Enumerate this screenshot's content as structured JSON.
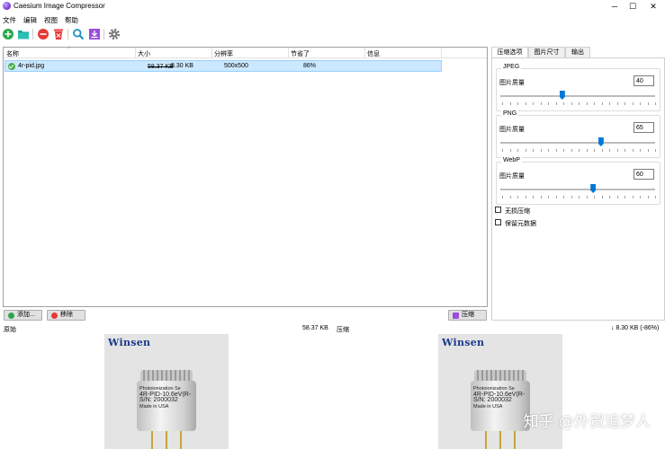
{
  "window": {
    "title": "Caesium Image Compressor",
    "minimize": "─",
    "maximize": "☐",
    "close": "✕"
  },
  "menu": [
    "文件",
    "编辑",
    "视图",
    "帮助"
  ],
  "toolbar": [
    "add-icon",
    "folder-icon",
    "remove-icon",
    "clear-icon",
    "search-icon",
    "export-icon",
    "settings-icon"
  ],
  "list": {
    "headers": [
      "名称",
      "大小",
      "分辨率",
      "节省了",
      "信息"
    ],
    "rows": [
      {
        "name": "4r-pid.jpg",
        "original_size": "58.37 KB",
        "size": "8.30 KB",
        "resolution": "500x500",
        "saved": "86%",
        "info": ""
      }
    ]
  },
  "tabs": [
    "压缩选项",
    "图片尺寸",
    "输出"
  ],
  "compression": {
    "jpeg": {
      "title": "JPEG",
      "label": "图片质量",
      "value": "40",
      "level": 40
    },
    "png": {
      "title": "PNG",
      "label": "图片质量",
      "value": "65",
      "level": 65
    },
    "webp": {
      "title": "WebP",
      "label": "图片质量",
      "value": "60",
      "level": 60
    },
    "lossless": "无损压缩",
    "keep_metadata": "保留元数据"
  },
  "buttons": {
    "add": "添加...",
    "remove": "移除",
    "compress": "压缩"
  },
  "preview": {
    "original_label": "原始",
    "original_size": "58.37 KB",
    "compressed_label": "压缩",
    "compressed_size": "↓ 8.30 KB (-86%)",
    "image": {
      "brand": "Winsen",
      "line1": "Photoionization Se",
      "line2": "4R-PID-10.6eV(R-",
      "line3": "S/N: 2000032",
      "line4": "Made in USA"
    },
    "watermark": "知乎 @外贸追梦人"
  },
  "colors": {
    "selection": "#cce8ff",
    "accent": "#0078d7",
    "brand": "#1a3a8a"
  }
}
